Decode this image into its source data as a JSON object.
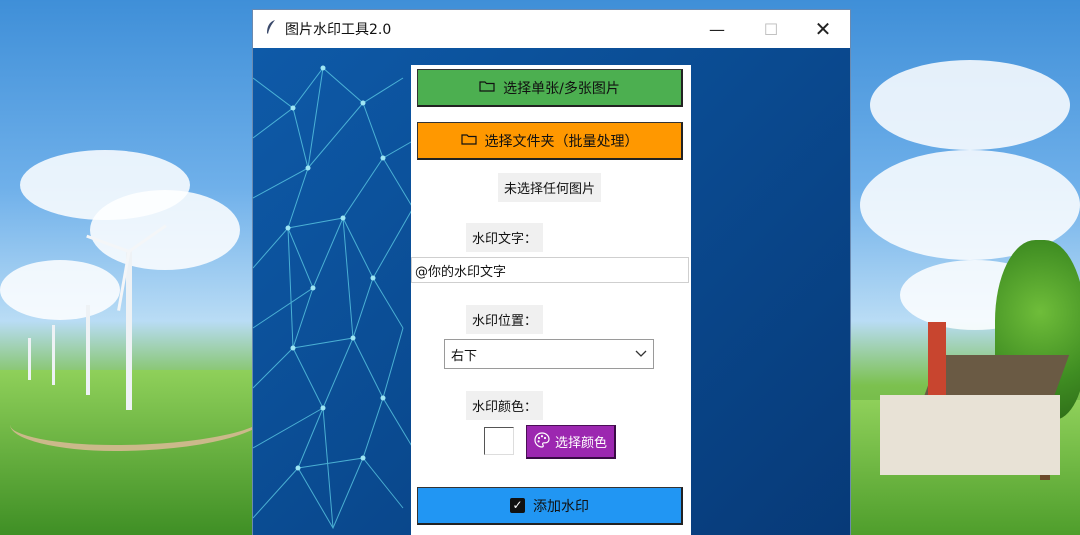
{
  "window": {
    "title": "图片水印工具2.0",
    "minimize_glyph": "—",
    "maximize_glyph": "☐",
    "close_glyph": "✕"
  },
  "buttons": {
    "select_images": "选择单张/多张图片",
    "select_folder": "选择文件夹（批量处理）",
    "choose_color": "选择颜色",
    "add_watermark": "添加水印"
  },
  "status": {
    "selection": "未选择任何图片"
  },
  "form": {
    "watermark_text_label": "水印文字：",
    "watermark_text_value": "@你的水印文字",
    "position_label": "水印位置：",
    "position_selected": "右下",
    "color_label": "水印颜色：",
    "color_value": "#ffffff"
  },
  "icons": {
    "app": "feather-icon",
    "folder": "folder-icon",
    "palette": "palette-icon",
    "checkbox": "checkbox-icon",
    "dropdown": "chevron-down-icon"
  },
  "colors": {
    "select_images_button": "#4caf50",
    "select_folder_button": "#ff9800",
    "choose_color_button": "#9c27b0",
    "add_watermark_button": "#2196f3"
  }
}
